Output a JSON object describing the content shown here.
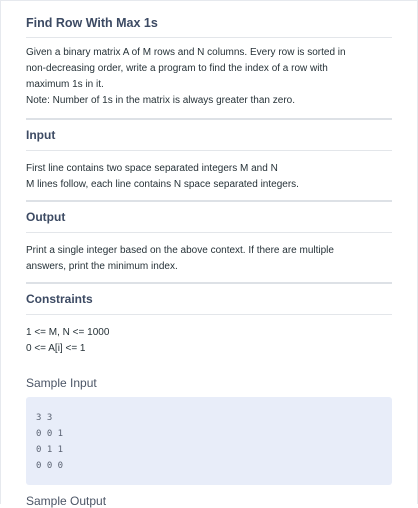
{
  "problem": {
    "title": "Find Row With Max 1s",
    "description": [
      "Given a binary matrix A of M rows and N columns. Every row is sorted in",
      "non-decreasing order, write a program to find the index of a row with",
      "maximum 1s in it.",
      "Note: Number of 1s in the matrix is always greater than zero."
    ]
  },
  "input_section": {
    "heading": "Input",
    "lines": [
      "First line contains two space separated integers M and N",
      "M lines follow, each line contains N space separated integers."
    ]
  },
  "output_section": {
    "heading": "Output",
    "lines": [
      "Print a single integer based on the above context. If there are multiple",
      "answers, print the minimum index."
    ]
  },
  "constraints_section": {
    "heading": "Constraints",
    "lines": [
      "1 <= M, N <= 1000",
      "0 <= A[i] <= 1"
    ]
  },
  "sample_input": {
    "heading": "Sample Input",
    "lines": [
      "3 3",
      "0 0 1",
      "0 1 1",
      "0 0 0"
    ]
  },
  "sample_output": {
    "heading": "Sample Output"
  }
}
